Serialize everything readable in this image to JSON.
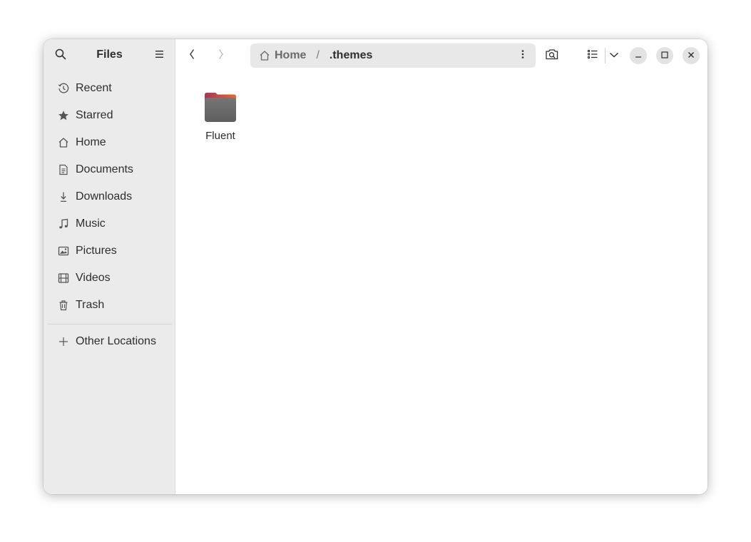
{
  "sidebar": {
    "title": "Files",
    "items": [
      {
        "label": "Recent",
        "icon": "clock-icon"
      },
      {
        "label": "Starred",
        "icon": "star-icon"
      },
      {
        "label": "Home",
        "icon": "home-icon"
      },
      {
        "label": "Documents",
        "icon": "document-icon"
      },
      {
        "label": "Downloads",
        "icon": "download-icon"
      },
      {
        "label": "Music",
        "icon": "music-icon"
      },
      {
        "label": "Pictures",
        "icon": "picture-icon"
      },
      {
        "label": "Videos",
        "icon": "film-icon"
      },
      {
        "label": "Trash",
        "icon": "trash-icon"
      }
    ],
    "other": {
      "label": "Other Locations",
      "icon": "plus-icon"
    }
  },
  "pathbar": {
    "home": "Home",
    "separator": "/",
    "current": ".themes"
  },
  "content": {
    "items": [
      {
        "label": "Fluent",
        "icon": "folder-icon",
        "colors": {
          "top": "#a8345a",
          "top_right": "#e8672f",
          "body": "#6e6e6e"
        }
      }
    ]
  },
  "colors": {
    "sidebar_bg": "#ebebeb",
    "pathbar_bg": "#e8e8e8",
    "window_button_bg": "#e3e3e3"
  }
}
